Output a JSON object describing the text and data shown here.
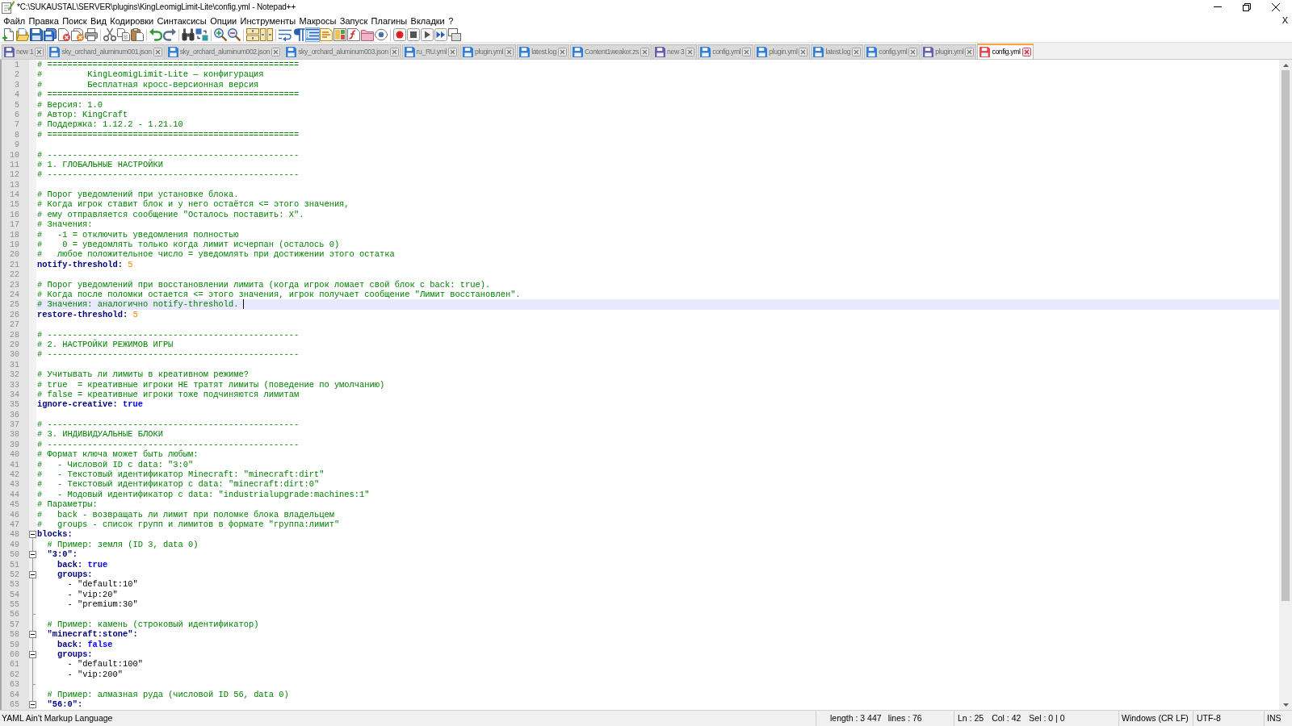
{
  "window": {
    "title": "*C:\\SUKAUSTAL\\SERVER\\plugins\\KingLeomigLimit-Lite\\config.yml - Notepad++"
  },
  "menu": {
    "items": [
      "Файл",
      "Правка",
      "Поиск",
      "Вид",
      "Кодировки",
      "Синтаксисы",
      "Опции",
      "Инструменты",
      "Макросы",
      "Запуск",
      "Плагины",
      "Вкладки",
      "?"
    ],
    "close_document": "X"
  },
  "toolbar": {
    "groups": [
      [
        {
          "kind": "new",
          "pressed": false
        },
        {
          "kind": "open",
          "pressed": false
        },
        {
          "kind": "save",
          "pressed": false
        },
        {
          "kind": "saveall",
          "pressed": false
        },
        {
          "kind": "close",
          "pressed": false
        },
        {
          "kind": "closeall",
          "pressed": false
        },
        {
          "kind": "print",
          "pressed": false
        }
      ],
      [
        {
          "kind": "cut",
          "pressed": false
        },
        {
          "kind": "copy",
          "pressed": false
        },
        {
          "kind": "paste",
          "pressed": false
        }
      ],
      [
        {
          "kind": "undo",
          "pressed": false
        },
        {
          "kind": "redo",
          "pressed": false
        }
      ],
      [
        {
          "kind": "find",
          "pressed": false
        },
        {
          "kind": "replace",
          "pressed": false
        }
      ],
      [
        {
          "kind": "zoomin",
          "pressed": false
        },
        {
          "kind": "zoomout",
          "pressed": false
        }
      ],
      [
        {
          "kind": "syncv",
          "pressed": false
        },
        {
          "kind": "synch",
          "pressed": false
        }
      ],
      [
        {
          "kind": "wrap",
          "pressed": false
        },
        {
          "kind": "allchars",
          "pressed": false
        },
        {
          "kind": "indent",
          "pressed": true
        },
        {
          "kind": "udl",
          "pressed": false
        },
        {
          "kind": "docmap",
          "pressed": false
        },
        {
          "kind": "funclist",
          "pressed": false
        },
        {
          "kind": "folder",
          "pressed": false
        },
        {
          "kind": "monitor",
          "pressed": false
        }
      ],
      [
        {
          "kind": "record",
          "pressed": false
        },
        {
          "kind": "stop",
          "pressed": false
        },
        {
          "kind": "play",
          "pressed": false
        },
        {
          "kind": "playmulti",
          "pressed": false
        },
        {
          "kind": "savemacro",
          "pressed": false
        }
      ]
    ]
  },
  "tabs": [
    {
      "label": "new 1",
      "color": "#5f5ea6",
      "selected": false
    },
    {
      "label": "sky_orchard_aluminum001.json",
      "color": "#2d7bd6",
      "selected": false
    },
    {
      "label": "sky_orchard_aluminum002.json",
      "color": "#2d7bd6",
      "selected": false
    },
    {
      "label": "sky_orchard_aluminum003.json",
      "color": "#2d7bd6",
      "selected": false
    },
    {
      "label": "ru_RU.yml",
      "color": "#2d7bd6",
      "selected": false
    },
    {
      "label": "plugin.yml",
      "color": "#2d7bd6",
      "selected": false
    },
    {
      "label": "latest.log",
      "color": "#2d7bd6",
      "selected": false
    },
    {
      "label": "Content1weaker.zs",
      "color": "#2d7bd6",
      "selected": false
    },
    {
      "label": "new 3",
      "color": "#5f5ea6",
      "selected": false
    },
    {
      "label": "config.yml",
      "color": "#2d7bd6",
      "selected": false
    },
    {
      "label": "plugin.yml",
      "color": "#2d7bd6",
      "selected": false
    },
    {
      "label": "latest.log",
      "color": "#2d7bd6",
      "selected": false
    },
    {
      "label": "config.yml",
      "color": "#2d7bd6",
      "selected": false
    },
    {
      "label": "plugin.yml",
      "color": "#5f5ea6",
      "selected": false
    },
    {
      "label": "config.yml",
      "color": "#e0454c",
      "selected": true
    }
  ],
  "editor": {
    "lines": [
      {
        "number": "1",
        "current": false,
        "spans": [
          {
            "kind": "comment",
            "text": "# =================================================="
          }
        ]
      },
      {
        "number": "2",
        "current": false,
        "spans": [
          {
            "kind": "comment",
            "text": "#         KingLeomigLimit-Lite — конфигурация"
          }
        ]
      },
      {
        "number": "3",
        "current": false,
        "spans": [
          {
            "kind": "comment",
            "text": "#         Бесплатная кросс-версионная версия"
          }
        ]
      },
      {
        "number": "4",
        "current": false,
        "spans": [
          {
            "kind": "comment",
            "text": "# =================================================="
          }
        ]
      },
      {
        "number": "5",
        "current": false,
        "spans": [
          {
            "kind": "comment",
            "text": "# Версия: 1.0"
          }
        ]
      },
      {
        "number": "6",
        "current": false,
        "spans": [
          {
            "kind": "comment",
            "text": "# Автор: KingCraft"
          }
        ]
      },
      {
        "number": "7",
        "current": false,
        "spans": [
          {
            "kind": "comment",
            "text": "# Поддержка: 1.12.2 - 1.21.10"
          }
        ]
      },
      {
        "number": "8",
        "current": false,
        "spans": [
          {
            "kind": "comment",
            "text": "# =================================================="
          }
        ]
      },
      {
        "number": "9",
        "current": false
      },
      {
        "number": "10",
        "current": false,
        "spans": [
          {
            "kind": "comment",
            "text": "# --------------------------------------------------"
          }
        ]
      },
      {
        "number": "11",
        "current": false,
        "spans": [
          {
            "kind": "comment",
            "text": "# 1. ГЛОБАЛЬНЫЕ НАСТРОЙКИ"
          }
        ]
      },
      {
        "number": "12",
        "current": false,
        "spans": [
          {
            "kind": "comment",
            "text": "# --------------------------------------------------"
          }
        ]
      },
      {
        "number": "13",
        "current": false
      },
      {
        "number": "14",
        "current": false,
        "spans": [
          {
            "kind": "comment",
            "text": "# Порог уведомлений при установке блока."
          }
        ]
      },
      {
        "number": "15",
        "current": false,
        "spans": [
          {
            "kind": "comment",
            "text": "# Когда игрок ставит блок и у него остаётся <= этого значения,"
          }
        ]
      },
      {
        "number": "16",
        "current": false,
        "spans": [
          {
            "kind": "comment",
            "text": "# ему отправляется сообщение \"Осталось поставить: X\"."
          }
        ]
      },
      {
        "number": "17",
        "current": false,
        "spans": [
          {
            "kind": "comment",
            "text": "# Значения:"
          }
        ]
      },
      {
        "number": "18",
        "current": false,
        "spans": [
          {
            "kind": "comment",
            "text": "#   -1 = отключить уведомления полностью"
          }
        ]
      },
      {
        "number": "19",
        "current": false,
        "spans": [
          {
            "kind": "comment",
            "text": "#    0 = уведомлять только когда лимит исчерпан (осталось 0)"
          }
        ]
      },
      {
        "number": "20",
        "current": false,
        "spans": [
          {
            "kind": "comment",
            "text": "#   любое положительное число = уведомлять при достижении этого остатка"
          }
        ]
      },
      {
        "number": "21",
        "current": false,
        "spans": [
          {
            "kind": "key",
            "text": "notify-threshold:"
          },
          {
            "kind": "number",
            "text": " 5"
          }
        ]
      },
      {
        "number": "22",
        "current": false
      },
      {
        "number": "23",
        "current": false,
        "spans": [
          {
            "kind": "comment",
            "text": "# Порог уведомлений при восстановлении лимита (когда игрок ломает свой блок с back: true)."
          }
        ]
      },
      {
        "number": "24",
        "current": false,
        "spans": [
          {
            "kind": "comment",
            "text": "# Когда после поломки остается <= этого значения, игрок получает сообщение \"Лимит восстановлен\"."
          }
        ]
      },
      {
        "number": "25",
        "current": true,
        "spans": [
          {
            "kind": "comment",
            "text": "# Значения: аналогично notify-threshold."
          }
        ]
      },
      {
        "number": "26",
        "current": false,
        "spans": [
          {
            "kind": "key",
            "text": "restore-threshold:"
          },
          {
            "kind": "number",
            "text": " 5"
          }
        ]
      },
      {
        "number": "27",
        "current": false
      },
      {
        "number": "28",
        "current": false,
        "spans": [
          {
            "kind": "comment",
            "text": "# --------------------------------------------------"
          }
        ]
      },
      {
        "number": "29",
        "current": false,
        "spans": [
          {
            "kind": "comment",
            "text": "# 2. НАСТРОЙКИ РЕЖИМОВ ИГРЫ"
          }
        ]
      },
      {
        "number": "30",
        "current": false,
        "spans": [
          {
            "kind": "comment",
            "text": "# --------------------------------------------------"
          }
        ]
      },
      {
        "number": "31",
        "current": false
      },
      {
        "number": "32",
        "current": false,
        "spans": [
          {
            "kind": "comment",
            "text": "# Учитывать ли лимиты в креативном режиме?"
          }
        ]
      },
      {
        "number": "33",
        "current": false,
        "spans": [
          {
            "kind": "comment",
            "text": "# true  = креативные игроки НЕ тратят лимиты (поведение по умолчанию)"
          }
        ]
      },
      {
        "number": "34",
        "current": false,
        "spans": [
          {
            "kind": "comment",
            "text": "# false = креативные игроки тоже подчиняются лимитам"
          }
        ]
      },
      {
        "number": "35",
        "current": false,
        "spans": [
          {
            "kind": "key",
            "text": "ignore-creative:"
          },
          {
            "kind": "bool",
            "text": " true"
          }
        ]
      },
      {
        "number": "36",
        "current": false
      },
      {
        "number": "37",
        "current": false,
        "spans": [
          {
            "kind": "comment",
            "text": "# --------------------------------------------------"
          }
        ]
      },
      {
        "number": "38",
        "current": false,
        "spans": [
          {
            "kind": "comment",
            "text": "# 3. ИНДИВИДУАЛЬНЫЕ БЛОКИ"
          }
        ]
      },
      {
        "number": "39",
        "current": false,
        "spans": [
          {
            "kind": "comment",
            "text": "# --------------------------------------------------"
          }
        ]
      },
      {
        "number": "40",
        "current": false,
        "spans": [
          {
            "kind": "comment",
            "text": "# Формат ключа может быть любым:"
          }
        ]
      },
      {
        "number": "41",
        "current": false,
        "spans": [
          {
            "kind": "comment",
            "text": "#   - Числовой ID с data: \"3:0\""
          }
        ]
      },
      {
        "number": "42",
        "current": false,
        "spans": [
          {
            "kind": "comment",
            "text": "#   - Текстовый идентификатор Minecraft: \"minecraft:dirt\""
          }
        ]
      },
      {
        "number": "43",
        "current": false,
        "spans": [
          {
            "kind": "comment",
            "text": "#   - Текстовый идентификатор с data: \"minecraft:dirt:0\""
          }
        ]
      },
      {
        "number": "44",
        "current": false,
        "spans": [
          {
            "kind": "comment",
            "text": "#   - Модовый идентификатор с data: \"industrialupgrade:machines:1\""
          }
        ]
      },
      {
        "number": "45",
        "current": false,
        "spans": [
          {
            "kind": "comment",
            "text": "# Параметры:"
          }
        ]
      },
      {
        "number": "46",
        "current": false,
        "spans": [
          {
            "kind": "comment",
            "text": "#   back - возвращать ли лимит при поломке блока владельцем"
          }
        ]
      },
      {
        "number": "47",
        "current": false,
        "spans": [
          {
            "kind": "comment",
            "text": "#   groups - список групп и лимитов в формате \"группа:лимит\""
          }
        ]
      },
      {
        "number": "48",
        "current": false,
        "expanded": true,
        "spans": [
          {
            "kind": "key",
            "text": "blocks:"
          }
        ]
      },
      {
        "number": "49",
        "current": false,
        "spans": [
          {
            "kind": "comment",
            "text": "  # Пример: земля (ID 3, data 0)"
          }
        ]
      },
      {
        "number": "50",
        "current": false,
        "expanded": true,
        "spans": [
          {
            "kind": "key",
            "text": "  \"3:0\":"
          }
        ]
      },
      {
        "number": "51",
        "current": false,
        "spans": [
          {
            "kind": "key",
            "text": "    back:"
          },
          {
            "kind": "bool",
            "text": " true"
          }
        ]
      },
      {
        "number": "52",
        "current": false,
        "expanded": true,
        "spans": [
          {
            "kind": "key",
            "text": "    groups:"
          }
        ]
      },
      {
        "number": "53",
        "current": false,
        "spans": [
          {
            "kind": "text",
            "text": "      - \"default:10\""
          }
        ]
      },
      {
        "number": "54",
        "current": false,
        "spans": [
          {
            "kind": "text",
            "text": "      - \"vip:20\""
          }
        ]
      },
      {
        "number": "55",
        "current": false,
        "spans": [
          {
            "kind": "text",
            "text": "      - \"premium:30\""
          }
        ]
      },
      {
        "number": "56",
        "current": false,
        "fold_end": true
      },
      {
        "number": "57",
        "current": false,
        "spans": [
          {
            "kind": "comment",
            "text": "  # Пример: камень (строковый идентификатор)"
          }
        ]
      },
      {
        "number": "58",
        "current": false,
        "expanded": true,
        "spans": [
          {
            "kind": "key",
            "text": "  \"minecraft:stone\":"
          }
        ]
      },
      {
        "number": "59",
        "current": false,
        "spans": [
          {
            "kind": "key",
            "text": "    back:"
          },
          {
            "kind": "bool",
            "text": " false"
          }
        ]
      },
      {
        "number": "60",
        "current": false,
        "expanded": true,
        "spans": [
          {
            "kind": "key",
            "text": "    groups:"
          }
        ]
      },
      {
        "number": "61",
        "current": false,
        "spans": [
          {
            "kind": "text",
            "text": "      - \"default:100\""
          }
        ]
      },
      {
        "number": "62",
        "current": false,
        "spans": [
          {
            "kind": "text",
            "text": "      - \"vip:200\""
          }
        ]
      },
      {
        "number": "63",
        "current": false,
        "fold_end": true
      },
      {
        "number": "64",
        "current": false,
        "spans": [
          {
            "kind": "comment",
            "text": "  # Пример: алмазная руда (числовой ID 56, data 0)"
          }
        ]
      },
      {
        "number": "65",
        "current": false,
        "expanded": true,
        "spans": [
          {
            "kind": "key",
            "text": "  \"56:0\":"
          }
        ]
      }
    ]
  },
  "status_bar": {
    "language": "YAML Ain't Markup Language",
    "length": "length : 3 447",
    "lines": "lines : 76",
    "line": "Ln : 25",
    "column": "Col : 42",
    "selection": "Sel : 0 | 0",
    "eol": "Windows (CR LF)",
    "encoding": "UTF-8",
    "mode": "INS"
  }
}
